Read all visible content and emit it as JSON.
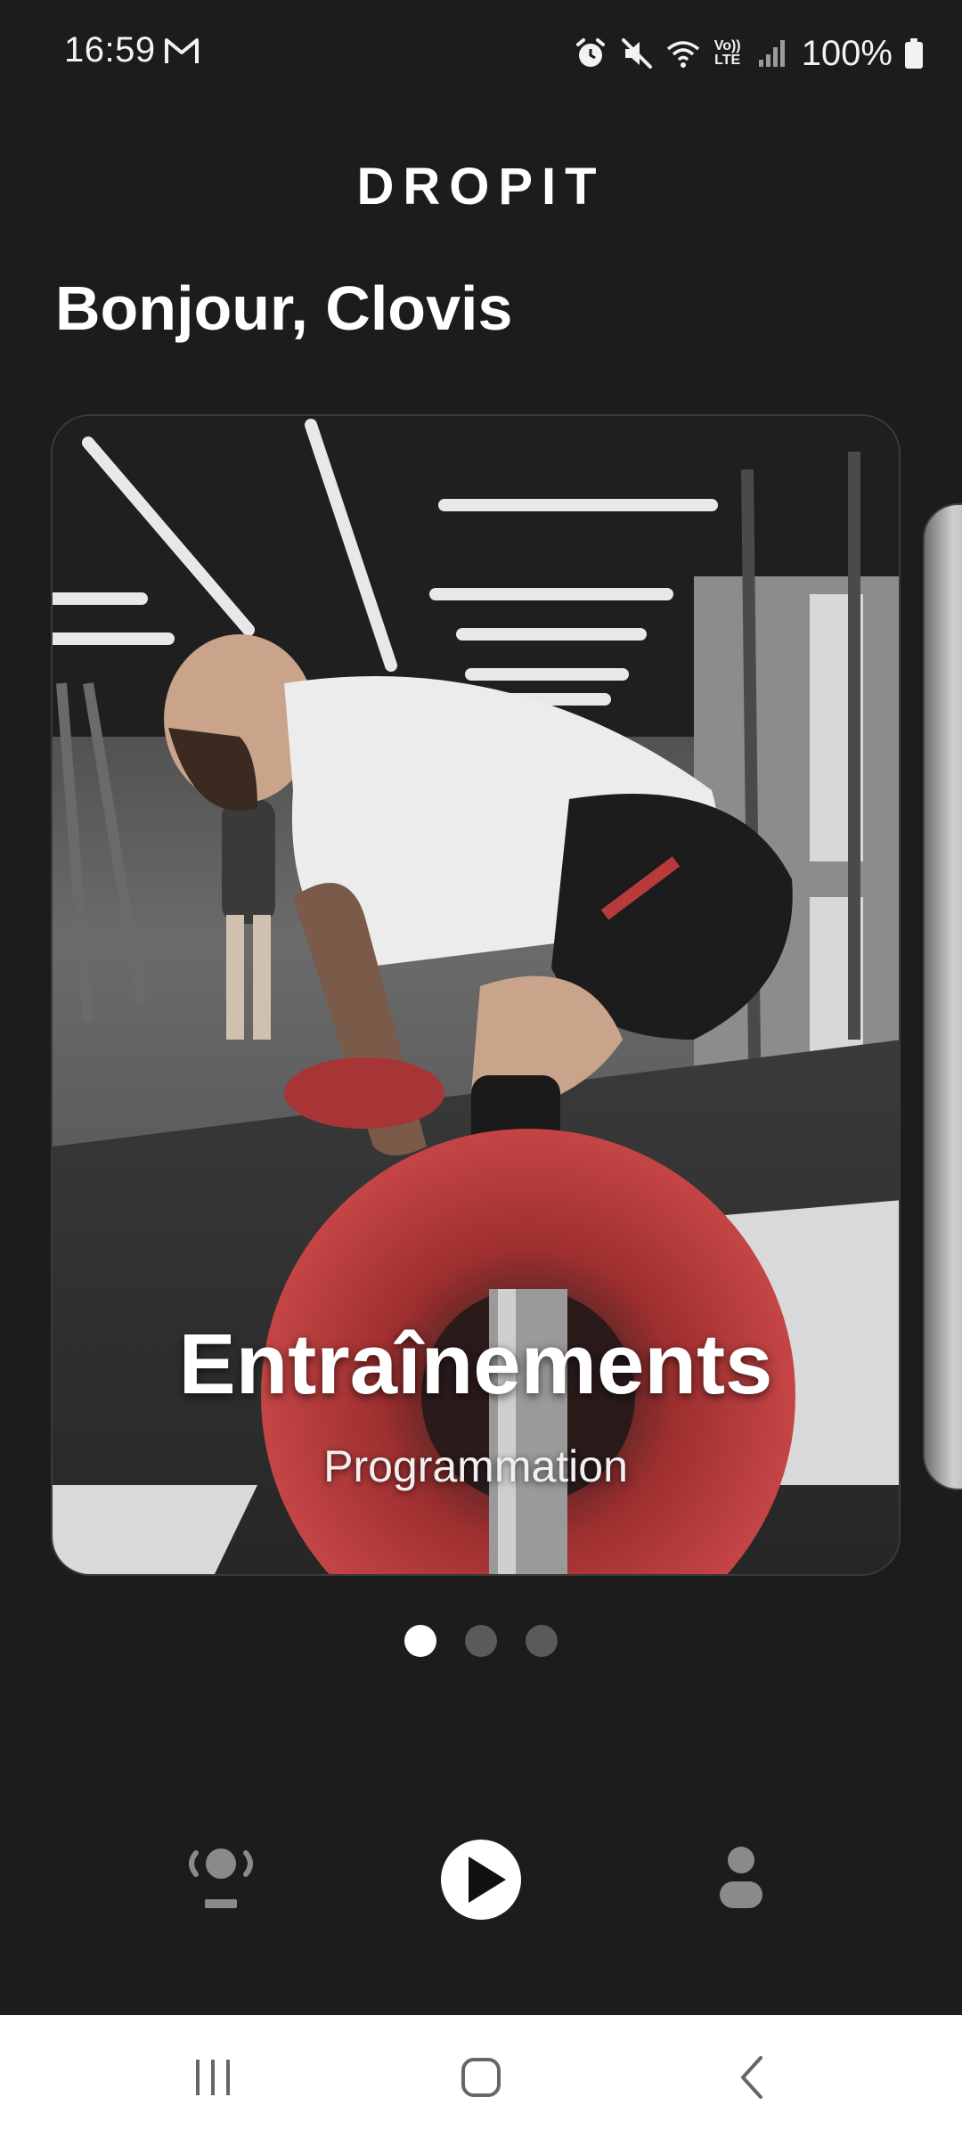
{
  "status_bar": {
    "time": "16:59",
    "mail_icon": "gmail-icon",
    "icons": [
      "alarm-icon",
      "mute-icon",
      "wifi-icon",
      "volte-icon",
      "signal-icon"
    ],
    "volte_top": "Vo))",
    "volte_bottom": "LTE",
    "battery_text": "100%"
  },
  "header": {
    "brand": "DROPIT",
    "greeting": "Bonjour, Clovis"
  },
  "carousel": {
    "cards": [
      {
        "title": "Entraînements",
        "subtitle": "Programmation"
      }
    ],
    "dot_count": 3,
    "active_index": 0
  },
  "bottom_nav": {
    "items": [
      {
        "icon": "coach-icon"
      },
      {
        "icon": "play-icon"
      },
      {
        "icon": "profile-icon"
      }
    ]
  },
  "system_nav": {
    "buttons": [
      "recent-apps-icon",
      "home-icon",
      "back-icon"
    ]
  },
  "colors": {
    "background": "#1c1c1c",
    "accent_red": "#b83a3a",
    "text": "#ffffff"
  }
}
